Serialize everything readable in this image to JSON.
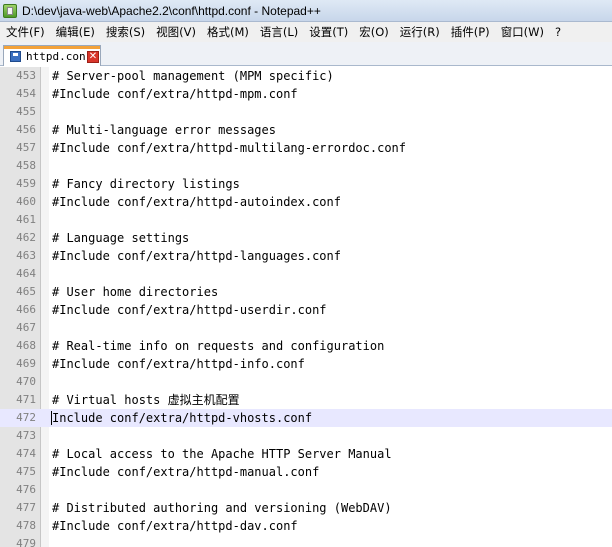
{
  "window": {
    "title": "D:\\dev\\java-web\\Apache2.2\\conf\\httpd.conf - Notepad++"
  },
  "menu": {
    "items": [
      {
        "label": "文件(F)"
      },
      {
        "label": "编辑(E)"
      },
      {
        "label": "搜索(S)"
      },
      {
        "label": "视图(V)"
      },
      {
        "label": "格式(M)"
      },
      {
        "label": "语言(L)"
      },
      {
        "label": "设置(T)"
      },
      {
        "label": "宏(O)"
      },
      {
        "label": "运行(R)"
      },
      {
        "label": "插件(P)"
      },
      {
        "label": "窗口(W)"
      },
      {
        "label": "?"
      }
    ]
  },
  "tabs": [
    {
      "label": "httpd.conf",
      "icon": "save-icon",
      "close_glyph": "✕",
      "accent": "#f3a23a"
    }
  ],
  "editor": {
    "current_line": 472,
    "highlight_color": "#e8e8ff",
    "lines": [
      {
        "number": "453",
        "text": "# Server-pool management (MPM specific)"
      },
      {
        "number": "454",
        "text": "#Include conf/extra/httpd-mpm.conf"
      },
      {
        "number": "455",
        "text": ""
      },
      {
        "number": "456",
        "text": "# Multi-language error messages"
      },
      {
        "number": "457",
        "text": "#Include conf/extra/httpd-multilang-errordoc.conf"
      },
      {
        "number": "458",
        "text": ""
      },
      {
        "number": "459",
        "text": "# Fancy directory listings"
      },
      {
        "number": "460",
        "text": "#Include conf/extra/httpd-autoindex.conf"
      },
      {
        "number": "461",
        "text": ""
      },
      {
        "number": "462",
        "text": "# Language settings"
      },
      {
        "number": "463",
        "text": "#Include conf/extra/httpd-languages.conf"
      },
      {
        "number": "464",
        "text": ""
      },
      {
        "number": "465",
        "text": "# User home directories"
      },
      {
        "number": "466",
        "text": "#Include conf/extra/httpd-userdir.conf"
      },
      {
        "number": "467",
        "text": ""
      },
      {
        "number": "468",
        "text": "# Real-time info on requests and configuration"
      },
      {
        "number": "469",
        "text": "#Include conf/extra/httpd-info.conf"
      },
      {
        "number": "470",
        "text": ""
      },
      {
        "number": "471",
        "text": "# Virtual hosts 虚拟主机配置"
      },
      {
        "number": "472",
        "text": "Include conf/extra/httpd-vhosts.conf"
      },
      {
        "number": "473",
        "text": ""
      },
      {
        "number": "474",
        "text": "# Local access to the Apache HTTP Server Manual"
      },
      {
        "number": "475",
        "text": "#Include conf/extra/httpd-manual.conf"
      },
      {
        "number": "476",
        "text": ""
      },
      {
        "number": "477",
        "text": "# Distributed authoring and versioning (WebDAV)"
      },
      {
        "number": "478",
        "text": "#Include conf/extra/httpd-dav.conf"
      },
      {
        "number": "479",
        "text": ""
      }
    ]
  }
}
